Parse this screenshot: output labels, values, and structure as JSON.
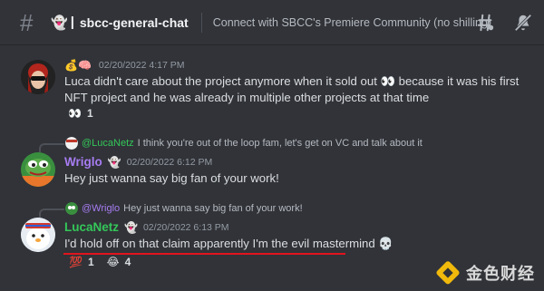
{
  "header": {
    "channel_emoji": "👻",
    "channel_bar": "|",
    "channel_name": "sbcc-general-chat",
    "topic": "Connect with SBCC's Premiere Community (no shilling)",
    "icons": [
      "threads-icon",
      "mute-icon"
    ]
  },
  "messages": [
    {
      "id": "m1",
      "badges": "💰🧠",
      "timestamp": "02/20/2022 4:17 PM",
      "lines": [
        "Luca didn't care about the project anymore when it sold out 👀 because it was his first",
        "NFT project and he was already in multiple other projects at that time"
      ],
      "reaction": {
        "emoji": "👀",
        "count": "1"
      }
    },
    {
      "id": "m2",
      "reply": {
        "author": "@LucaNetz",
        "text": "I think you're out of the loop fam, let's get on VC and talk about it"
      },
      "author": "Wriglo",
      "author_badge": "👻",
      "timestamp": "02/20/2022 6:12 PM",
      "text": "Hey just wanna say big fan of your work!"
    },
    {
      "id": "m3",
      "reply": {
        "author": "@Wriglo",
        "text": "Hey just wanna say big fan of your work!"
      },
      "author": "LucaNetz",
      "author_badge": "👻",
      "timestamp": "02/20/2022 6:13 PM",
      "text": "I'd hold off on that claim apparently I'm the evil mastermind 💀",
      "reactions": [
        {
          "emoji": "💯",
          "count": "1"
        },
        {
          "emoji": "😂",
          "count": "4"
        }
      ]
    }
  ],
  "watermark": {
    "text": "金色财经"
  },
  "colors": {
    "background": "#313338",
    "wriglo": "#a77cf2",
    "lucanetz": "#34c759",
    "underline": "#e0141e",
    "reply_mention_1": "#34c759",
    "reply_mention_2": "#a77cf2"
  }
}
